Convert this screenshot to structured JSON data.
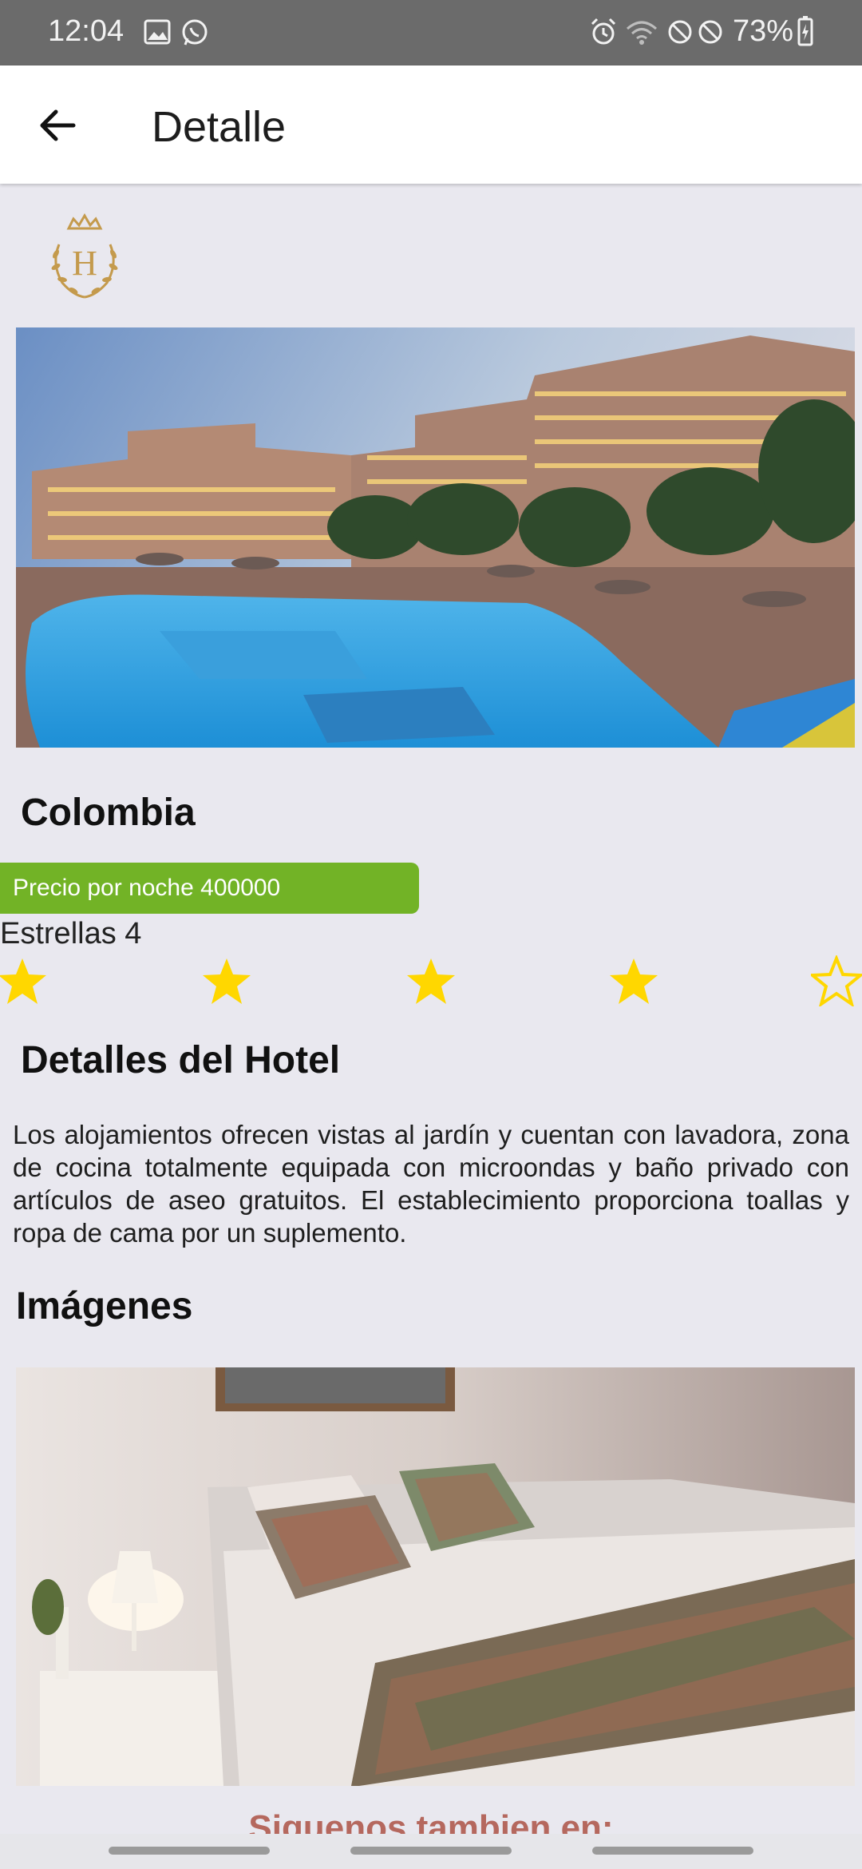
{
  "status_bar": {
    "time": "12:04",
    "battery": "73%"
  },
  "app_bar": {
    "title": "Detalle",
    "back_icon": "arrow-left-icon"
  },
  "hotel": {
    "logo_letter": "H",
    "city": "Colombia",
    "price_label": "Precio por noche 400000",
    "stars_label": "Estrellas 4",
    "rating": 4,
    "max_rating": 5,
    "details_title": "Detalles del Hotel",
    "description": "Los alojamientos ofrecen vistas al jardín y cuentan con lavadora, zona de cocina totalmente equipada con microondas y baño privado con artículos de aseo gratuitos. El establecimiento proporciona toallas y ropa de cama por un suplemento.",
    "images_title": "Imágenes",
    "follow_title": "Siguenos tambien en:"
  },
  "colors": {
    "price_bg": "#72b326",
    "star": "#ffd700",
    "follow_text": "#b5685e",
    "status_bar": "#6b6b6b"
  }
}
